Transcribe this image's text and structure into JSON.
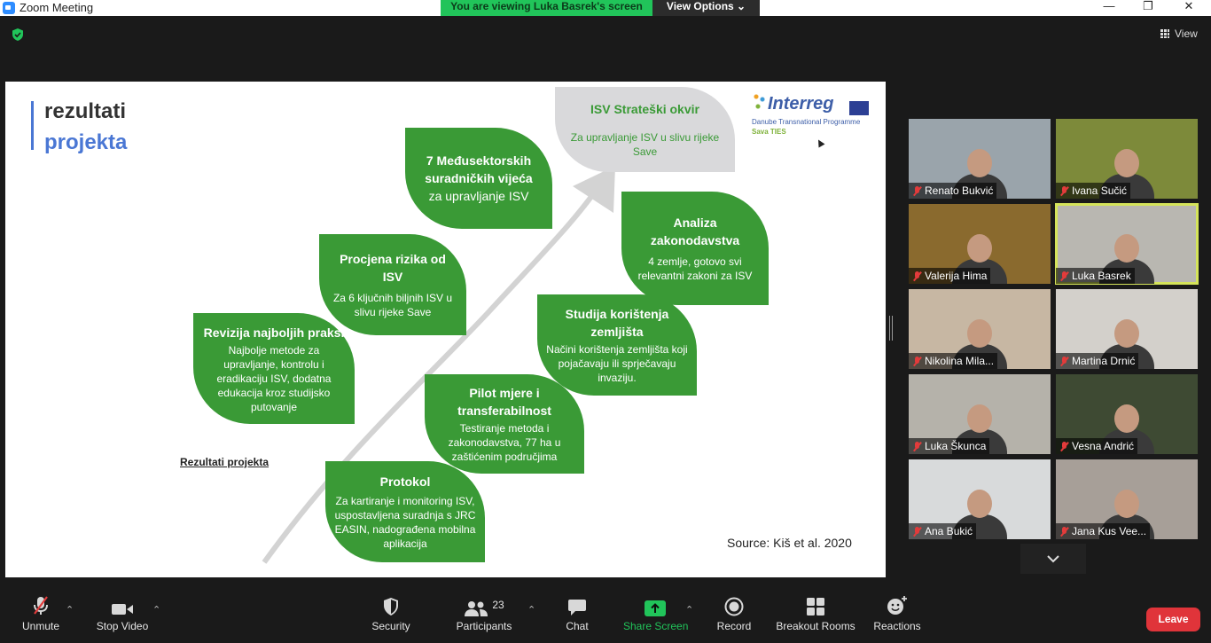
{
  "window": {
    "title": "Zoom Meeting",
    "controls": {
      "minimize": "—",
      "maximize": "❐",
      "close": "✕"
    }
  },
  "share_banner": {
    "text": "You are viewing Luka Basrek's screen",
    "view_options": "View Options ⌄"
  },
  "view_button": "View",
  "slide": {
    "title_line1": "rezultati",
    "title_line2": "projekta",
    "logo": {
      "word": "Interreg",
      "line1": "Danube Transnational Programme",
      "line2": "Sava TIES"
    },
    "leaves": {
      "strateski": {
        "heading": "ISV Strateški okvir",
        "body": "Za upravljanje ISV u slivu rijeke Save"
      },
      "vijeca": {
        "heading": "7 Međusektorskih suradničkih vijeća",
        "body": "za upravljanje ISV"
      },
      "rizik": {
        "heading": "Procjena rizika od ISV",
        "body": "Za 6 ključnih biljnih ISV u slivu rijeke Save"
      },
      "zakonodavstvo": {
        "heading": "Analiza zakonodavstva",
        "body": "4 zemlje, gotovo svi relevantni zakoni za ISV"
      },
      "revizija": {
        "heading": "Revizija najboljih praksi",
        "body": "Najbolje metode za upravljanje, kontrolu i eradikaciju ISV, dodatna edukacija kroz studijsko putovanje"
      },
      "zemljista": {
        "heading": "Studija korištenja zemljišta",
        "body": "Načini korištenja zemljišta koji pojačavaju ili sprječavaju invaziju."
      },
      "pilot": {
        "heading": "Pilot mjere i transferabilnost",
        "body": "Testiranje metoda i zakonodavstva, 77 ha u zaštićenim područjima"
      },
      "protokol": {
        "heading": "Protokol",
        "body": "Za kartiranje i monitoring ISV, uspostavljena suradnja s JRC EASIN, nadograđena mobilna aplikacija"
      }
    },
    "link": "Rezultati projekta",
    "source": "Source: Kiš et al. 2020"
  },
  "participants": [
    {
      "name": "Renato Bukvić",
      "bg": "#9aa4ab"
    },
    {
      "name": "Ivana Sučić",
      "bg": "#7d8a3a"
    },
    {
      "name": "Valerija Hima",
      "bg": "#8a6a2e"
    },
    {
      "name": "Luka Basrek",
      "bg": "#b9b7b1"
    },
    {
      "name": "Nikolina Mila...",
      "bg": "#c7b7a3"
    },
    {
      "name": "Martina Drnić",
      "bg": "#d3d0cb"
    },
    {
      "name": "Luka Škunca",
      "bg": "#b5b2aa"
    },
    {
      "name": "Vesna Andrić",
      "bg": "#3e4a33"
    },
    {
      "name": "Ana Bukić",
      "bg": "#d8dadb"
    },
    {
      "name": "Jana Kus Vee...",
      "bg": "#a79f98"
    }
  ],
  "toolbar": {
    "unmute": "Unmute",
    "stop_video": "Stop Video",
    "security": "Security",
    "participants": "Participants",
    "participants_count": "23",
    "chat": "Chat",
    "share_screen": "Share Screen",
    "record": "Record",
    "breakout": "Breakout Rooms",
    "reactions": "Reactions",
    "leave": "Leave"
  },
  "colors": {
    "leaf_green": "#3a9a36",
    "accent_blue": "#4a77d4",
    "share_green": "#21c45a",
    "leave_red": "#e0343a",
    "active_speaker": "#d5e45a"
  }
}
